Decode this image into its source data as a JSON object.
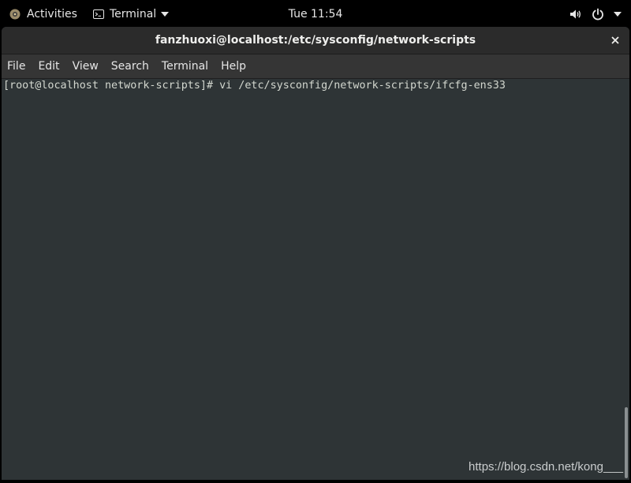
{
  "topbar": {
    "activities_label": "Activities",
    "app_menu_label": "Terminal",
    "clock": "Tue 11:54",
    "icons": [
      "fedora-logo-icon",
      "terminal-icon",
      "chevron-down-icon",
      "volume-icon",
      "power-icon",
      "chevron-down-icon"
    ]
  },
  "window": {
    "title": "fanzhuoxi@localhost:/etc/sysconfig/network-scripts",
    "close_icon": "close-icon"
  },
  "menubar": {
    "items": [
      "File",
      "Edit",
      "View",
      "Search",
      "Terminal",
      "Help"
    ]
  },
  "terminal": {
    "lines": [
      "[root@localhost network-scripts]# vi /etc/sysconfig/network-scripts/ifcfg-ens33"
    ]
  },
  "watermark": "https://blog.csdn.net/kong___",
  "colors": {
    "topbar_bg": "#000000",
    "terminal_bg": "#2e3436",
    "terminal_fg": "#d3d7cf",
    "titlebar_bg": "#2b2b2b",
    "menubar_bg": "#353535"
  }
}
